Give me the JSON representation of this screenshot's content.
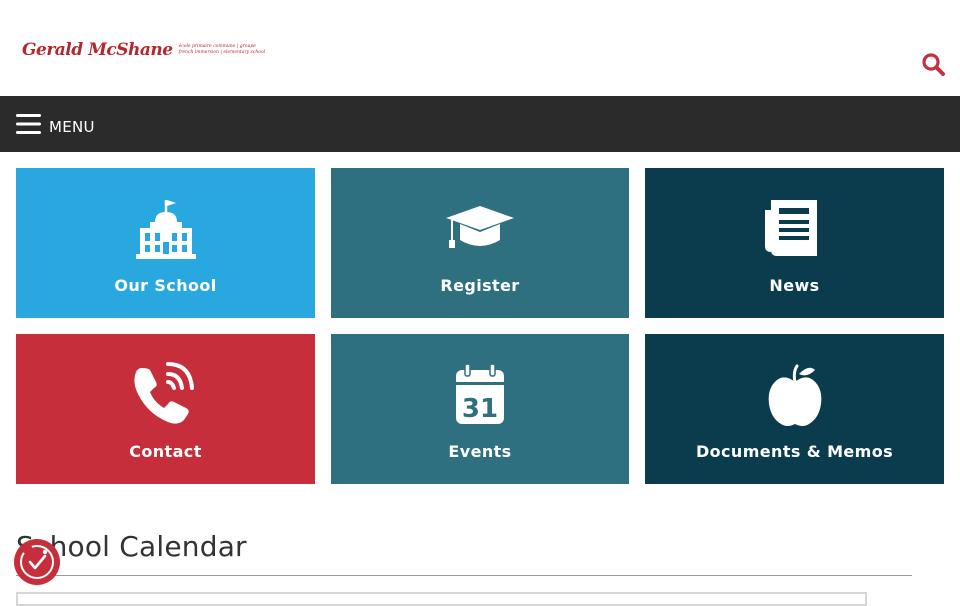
{
  "header": {
    "logo": {
      "name": "Gerald McShane",
      "tagline_lines": [
        "école primaire commune | groupe",
        "french immersion | elementary school"
      ]
    },
    "search_icon": "search-icon"
  },
  "menu": {
    "label": "MENU",
    "icon": "hamburger-icon"
  },
  "tiles": [
    {
      "label": "Our School",
      "icon": "school-building-icon",
      "color": "#29a8e0"
    },
    {
      "label": "Register",
      "icon": "graduation-cap-icon",
      "color": "#2e6f80"
    },
    {
      "label": "News",
      "icon": "newspaper-icon",
      "color": "#0b3c4e"
    },
    {
      "label": "Contact",
      "icon": "phone-icon",
      "color": "#c62e3c"
    },
    {
      "label": "Events",
      "icon": "calendar-icon",
      "calendar_day": "31",
      "color": "#2e6f80"
    },
    {
      "label": "Documents & Memos",
      "icon": "apple-icon",
      "color": "#0b3c4e"
    }
  ],
  "calendar_section": {
    "title": "School Calendar"
  },
  "accessibility": {
    "icon": "accessibility-icon",
    "color": "#c62e3c"
  },
  "colors": {
    "menu_bar": "#2b2b2b",
    "brand_red": "#b3272d",
    "search_icon": "#c62e3c"
  }
}
